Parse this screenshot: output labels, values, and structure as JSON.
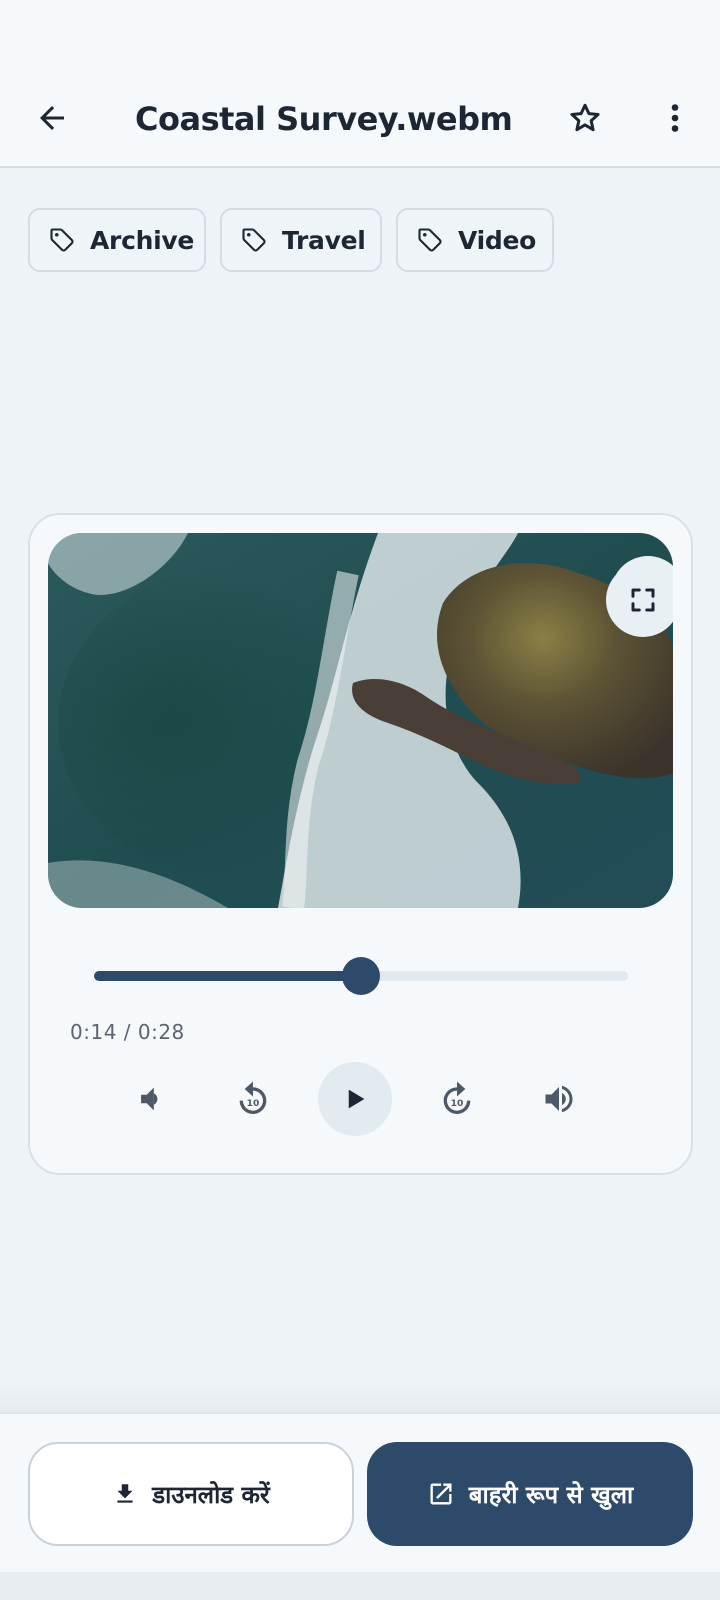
{
  "header": {
    "title": "Coastal Survey.webm",
    "back_icon": "arrow-left-icon",
    "favorite_icon": "star-outline-icon",
    "more_icon": "more-vertical-icon"
  },
  "tags": [
    {
      "label": "Archive",
      "icon": "tag-icon"
    },
    {
      "label": "Travel",
      "icon": "tag-icon"
    },
    {
      "label": "Video",
      "icon": "tag-icon"
    }
  ],
  "player": {
    "time_display": "0:14 / 0:28",
    "progress_fraction": 0.5,
    "controls": [
      "volume-down-icon",
      "replay-10-icon",
      "play-icon",
      "forward-10-icon",
      "volume-up-icon"
    ],
    "replay_label": "10",
    "forward_label": "10"
  },
  "actions": {
    "download_label": "डाउनलोड करें",
    "open_external_label": "बाहरी रूप से खुला"
  },
  "colors": {
    "primary": "#2e4a6a",
    "background": "#eef3f7",
    "surface": "#f6f9fc"
  }
}
